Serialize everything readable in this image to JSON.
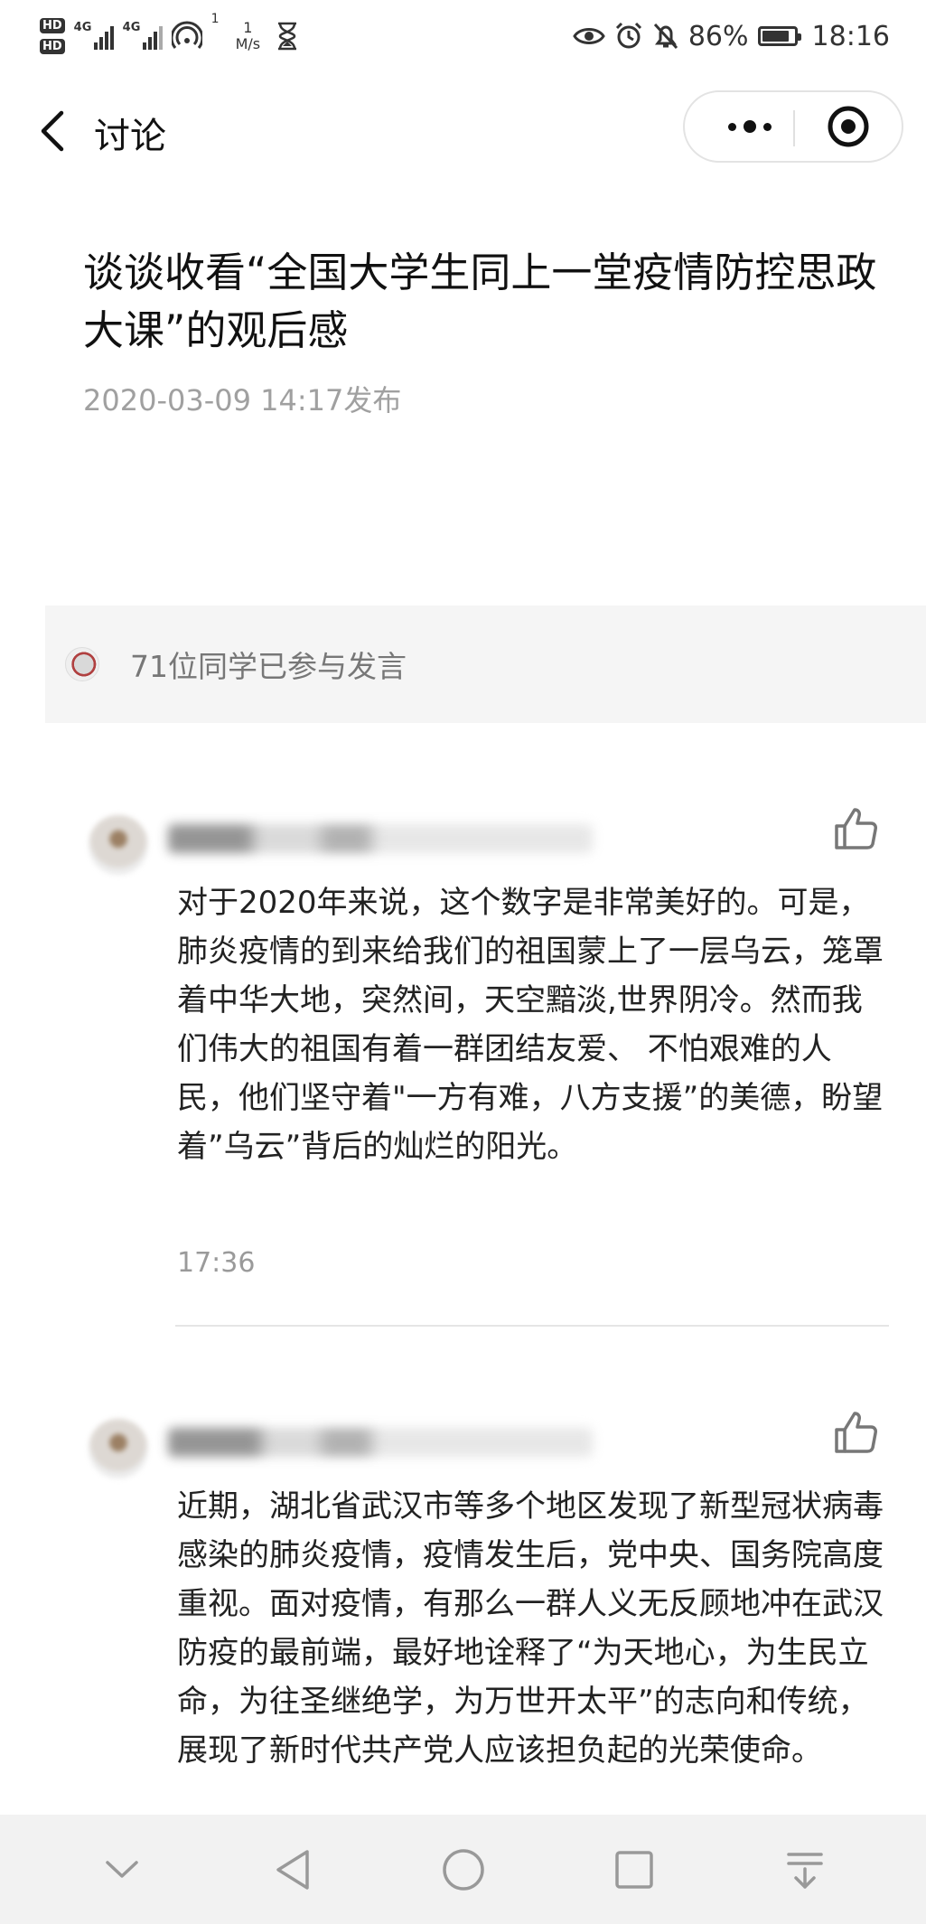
{
  "status_bar": {
    "hd_labels": [
      "HD",
      "HD"
    ],
    "network_labels": [
      "4G",
      "4G"
    ],
    "hotspot_count": "1",
    "speed_value": "1",
    "speed_unit": "M/s",
    "battery": "86%",
    "battery_level": 0.86,
    "time": "18:16"
  },
  "nav": {
    "title": "讨论"
  },
  "article": {
    "title": "谈谈收看“全国大学生同上一堂疫情防控思政大课”的观后感",
    "date": "2020-03-09 14:17发布"
  },
  "participants": {
    "text": "71位同学已参与发言"
  },
  "comments": [
    {
      "text": "对于2020年来说，这个数字是非常美好的。可是，肺炎疫情的到来给我们的祖国蒙上了一层乌云，笼罩着中华大地，突然间，天空黯淡,世界阴冷。然而我们伟大的祖国有着一群团结友爱、 不怕艰难的人民，他们坚守着\"一方有难，八方支援”的美德，盼望着”乌云”背后的灿烂的阳光。",
      "time": "17:36"
    },
    {
      "text": "近期，湖北省武汉市等多个地区发现了新型冠状病毒感染的肺炎疫情，疫情发生后，党中央、国务院高度重视。面对疫情，有那么一群人义无反顾地冲在武汉防疫的最前端，最好地诠释了“为天地心，为生民立命，为往圣继绝学，为万世开太平”的志向和传统，展现了新时代共产党人应该担负起的光荣使命。"
    }
  ],
  "icons": {
    "back": "chevron-left-icon",
    "more": "more-dots-icon",
    "close": "target-circle-icon",
    "like": "thumbs-up-icon",
    "sys_nav": [
      "chevron-down-icon",
      "back-triangle-icon",
      "home-circle-icon",
      "recents-square-icon",
      "pull-down-icon"
    ]
  }
}
